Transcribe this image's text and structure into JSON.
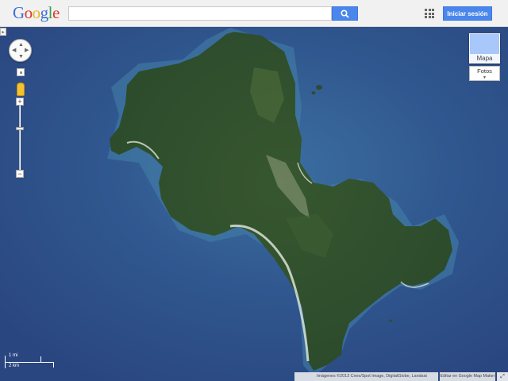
{
  "header": {
    "logo_letters": [
      "G",
      "o",
      "o",
      "g",
      "l",
      "e"
    ],
    "search": {
      "value": "",
      "placeholder": ""
    },
    "search_icon": "magnifier-icon",
    "apps_icon": "apps-grid-icon",
    "signin_label": "Iniciar sesión"
  },
  "map": {
    "view": "satellite",
    "controls": {
      "panel_toggle_icon": "arrow-right-icon",
      "pan_icon": "pan-arrows-icon",
      "pegman_icon": "pegman-icon",
      "zoom_in": "+",
      "zoom_out": "−"
    },
    "maptype": {
      "map_label": "Mapa",
      "fotos_label": "Fotos",
      "fotos_icon": "caret-down-icon"
    },
    "scale": {
      "miles": "1 mi",
      "km": "2 km"
    },
    "attribution": "Imágenes ©2013 Cnes/Spot Image, DigitalGlobe, Landsat",
    "mapmaker_link": "Editar en Google Map Maker",
    "expand_icon": "expand-icon",
    "colors": {
      "sea_deep": "#2d4f87",
      "sea_shallow": "#3f79a6",
      "land": "#2f4e2c",
      "beach": "#cfd8c8"
    }
  }
}
